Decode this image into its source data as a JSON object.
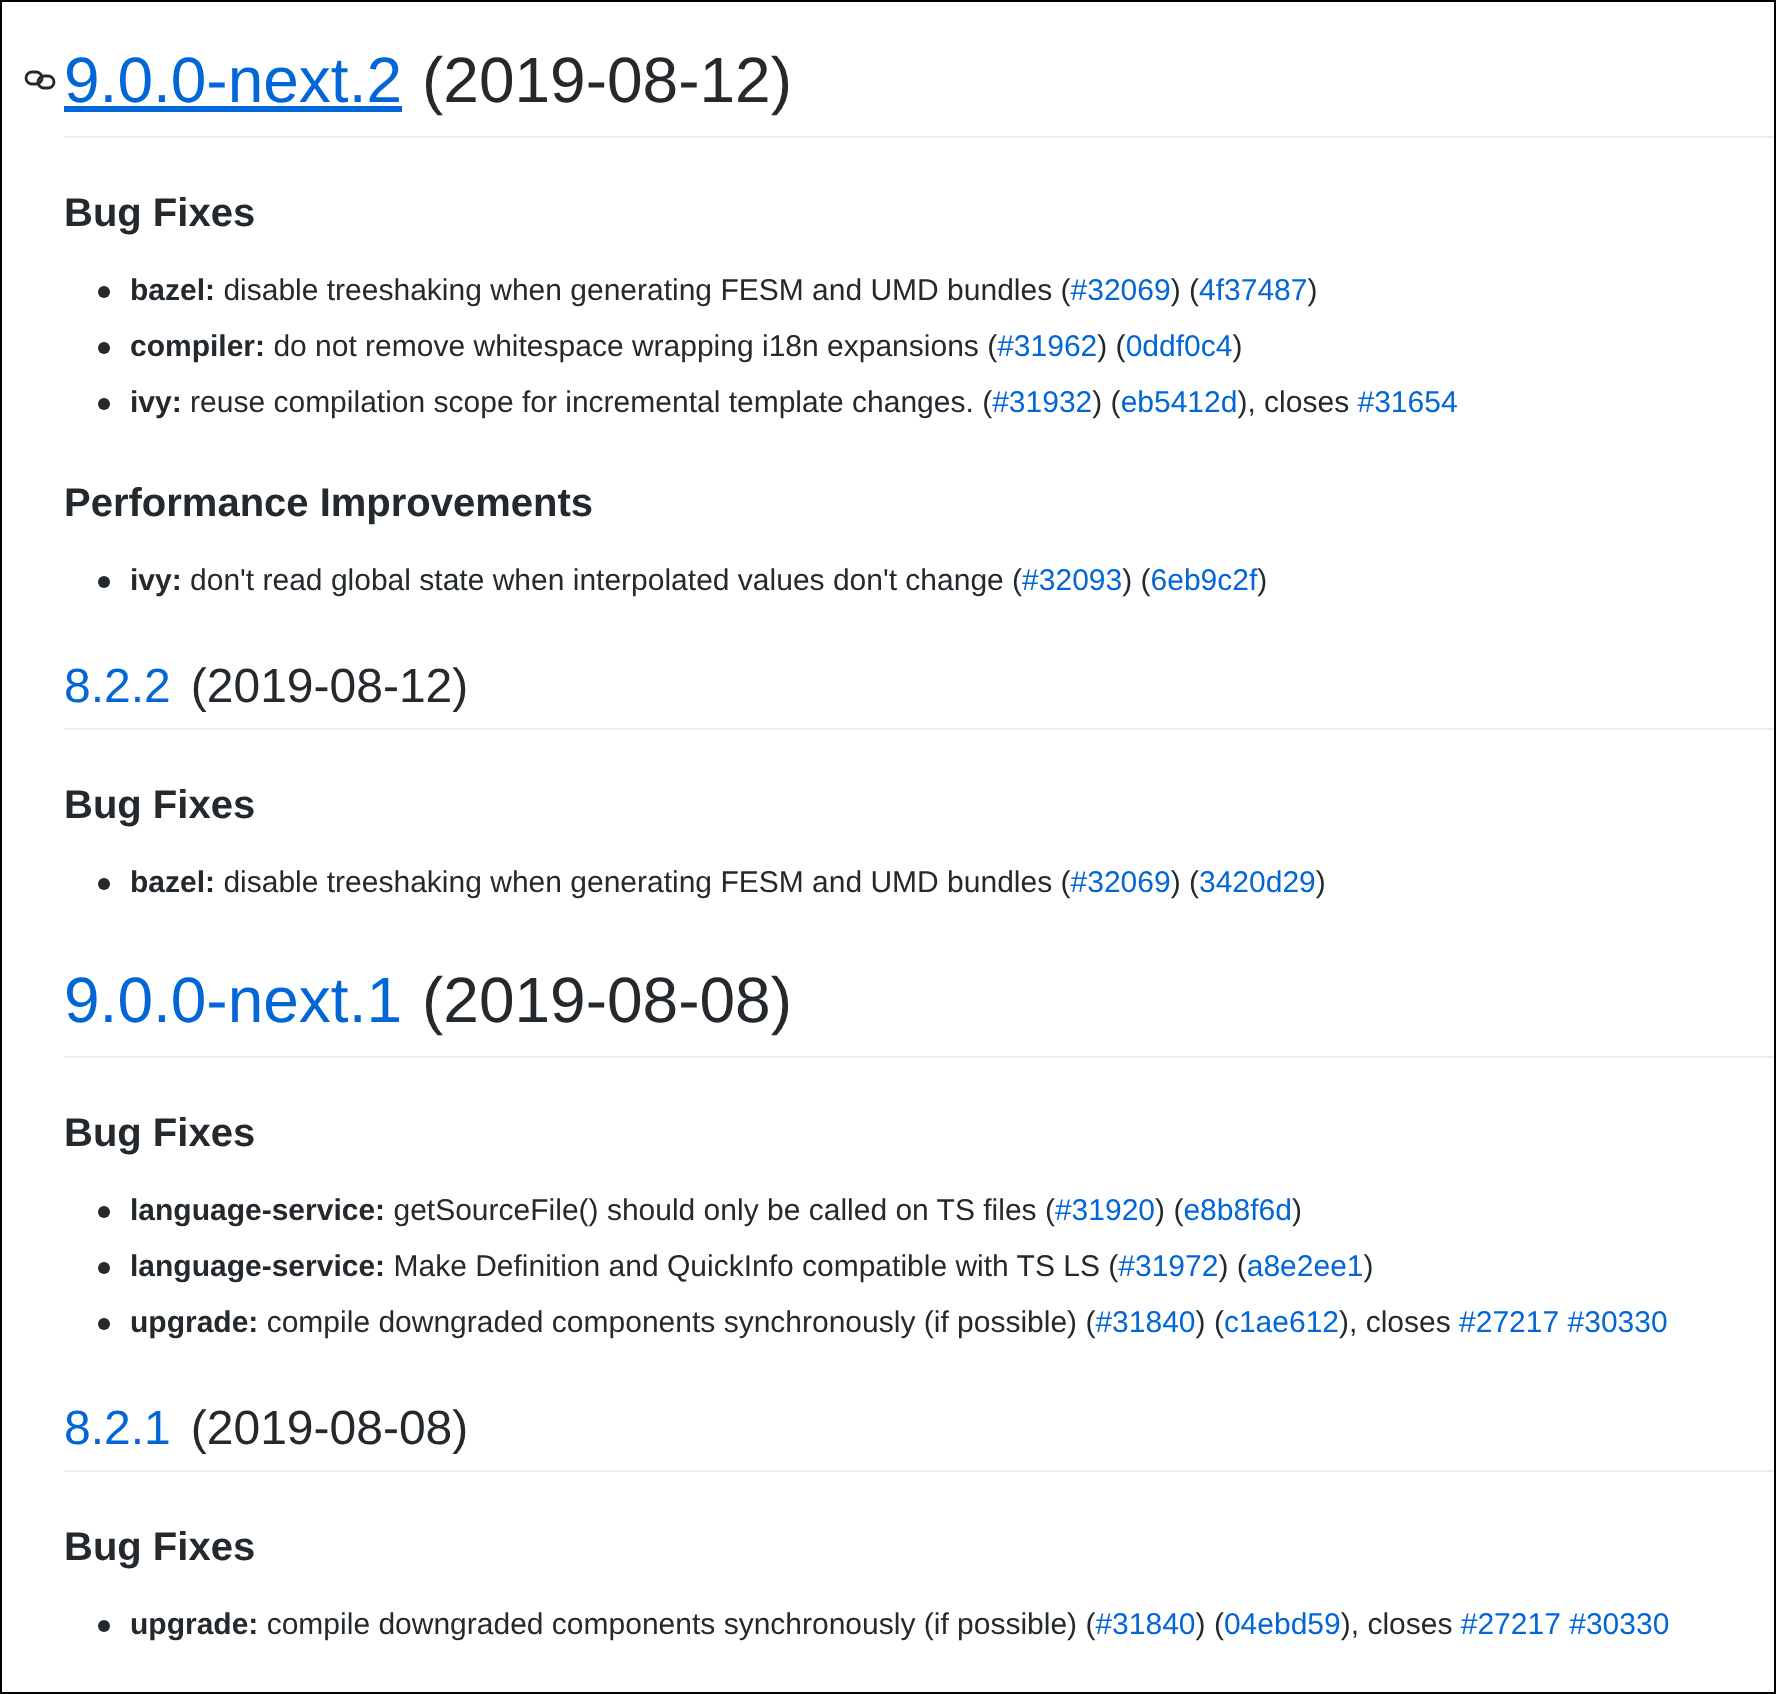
{
  "releases": [
    {
      "version": "9.0.0-next.2",
      "date": "(2019-08-12)",
      "kind": "major",
      "hovered": true,
      "sections": [
        {
          "title": "Bug Fixes",
          "items": [
            {
              "scope": "bazel:",
              "segments": [
                {
                  "kind": "text",
                  "text": "disable treeshaking when generating FESM and UMD bundles ("
                },
                {
                  "kind": "issue",
                  "text": "#32069"
                },
                {
                  "kind": "text",
                  "text": ") ("
                },
                {
                  "kind": "commit",
                  "text": "4f37487"
                },
                {
                  "kind": "text",
                  "text": ")"
                }
              ]
            },
            {
              "scope": "compiler:",
              "segments": [
                {
                  "kind": "text",
                  "text": "do not remove whitespace wrapping i18n expansions ("
                },
                {
                  "kind": "issue",
                  "text": "#31962"
                },
                {
                  "kind": "text",
                  "text": ") ("
                },
                {
                  "kind": "commit",
                  "text": "0ddf0c4"
                },
                {
                  "kind": "text",
                  "text": ")"
                }
              ]
            },
            {
              "scope": "ivy:",
              "segments": [
                {
                  "kind": "text",
                  "text": "reuse compilation scope for incremental template changes. ("
                },
                {
                  "kind": "issue",
                  "text": "#31932"
                },
                {
                  "kind": "text",
                  "text": ") ("
                },
                {
                  "kind": "commit",
                  "text": "eb5412d"
                },
                {
                  "kind": "text",
                  "text": "), closes "
                },
                {
                  "kind": "issue",
                  "text": "#31654"
                }
              ]
            }
          ]
        },
        {
          "title": "Performance Improvements",
          "items": [
            {
              "scope": "ivy:",
              "segments": [
                {
                  "kind": "text",
                  "text": "don't read global state when interpolated values don't change ("
                },
                {
                  "kind": "issue",
                  "text": "#32093"
                },
                {
                  "kind": "text",
                  "text": ") ("
                },
                {
                  "kind": "commit",
                  "text": "6eb9c2f"
                },
                {
                  "kind": "text",
                  "text": ")"
                }
              ]
            }
          ]
        }
      ]
    },
    {
      "version": "8.2.2",
      "date": "(2019-08-12)",
      "kind": "minor",
      "hovered": false,
      "sections": [
        {
          "title": "Bug Fixes",
          "items": [
            {
              "scope": "bazel:",
              "segments": [
                {
                  "kind": "text",
                  "text": "disable treeshaking when generating FESM and UMD bundles ("
                },
                {
                  "kind": "issue",
                  "text": "#32069"
                },
                {
                  "kind": "text",
                  "text": ") ("
                },
                {
                  "kind": "commit",
                  "text": "3420d29"
                },
                {
                  "kind": "text",
                  "text": ")"
                }
              ]
            }
          ]
        }
      ]
    },
    {
      "version": "9.0.0-next.1",
      "date": "(2019-08-08)",
      "kind": "major",
      "hovered": false,
      "sections": [
        {
          "title": "Bug Fixes",
          "items": [
            {
              "scope": "language-service:",
              "segments": [
                {
                  "kind": "text",
                  "text": "getSourceFile() should only be called on TS files ("
                },
                {
                  "kind": "issue",
                  "text": "#31920"
                },
                {
                  "kind": "text",
                  "text": ") ("
                },
                {
                  "kind": "commit",
                  "text": "e8b8f6d"
                },
                {
                  "kind": "text",
                  "text": ")"
                }
              ]
            },
            {
              "scope": "language-service:",
              "segments": [
                {
                  "kind": "text",
                  "text": "Make Definition and QuickInfo compatible with TS LS ("
                },
                {
                  "kind": "issue",
                  "text": "#31972"
                },
                {
                  "kind": "text",
                  "text": ") ("
                },
                {
                  "kind": "commit",
                  "text": "a8e2ee1"
                },
                {
                  "kind": "text",
                  "text": ")"
                }
              ]
            },
            {
              "scope": "upgrade:",
              "segments": [
                {
                  "kind": "text",
                  "text": "compile downgraded components synchronously (if possible) ("
                },
                {
                  "kind": "issue",
                  "text": "#31840"
                },
                {
                  "kind": "text",
                  "text": ") ("
                },
                {
                  "kind": "commit",
                  "text": "c1ae612"
                },
                {
                  "kind": "text",
                  "text": "), closes "
                },
                {
                  "kind": "issue",
                  "text": "#27217"
                },
                {
                  "kind": "issue",
                  "text": "#30330"
                }
              ]
            }
          ]
        }
      ]
    },
    {
      "version": "8.2.1",
      "date": "(2019-08-08)",
      "kind": "minor",
      "hovered": false,
      "sections": [
        {
          "title": "Bug Fixes",
          "items": [
            {
              "scope": "upgrade:",
              "segments": [
                {
                  "kind": "text",
                  "text": "compile downgraded components synchronously (if possible) ("
                },
                {
                  "kind": "issue",
                  "text": "#31840"
                },
                {
                  "kind": "text",
                  "text": ") ("
                },
                {
                  "kind": "commit",
                  "text": "04ebd59"
                },
                {
                  "kind": "text",
                  "text": "), closes "
                },
                {
                  "kind": "issue",
                  "text": "#27217"
                },
                {
                  "kind": "issue",
                  "text": "#30330"
                }
              ]
            }
          ]
        }
      ]
    }
  ]
}
